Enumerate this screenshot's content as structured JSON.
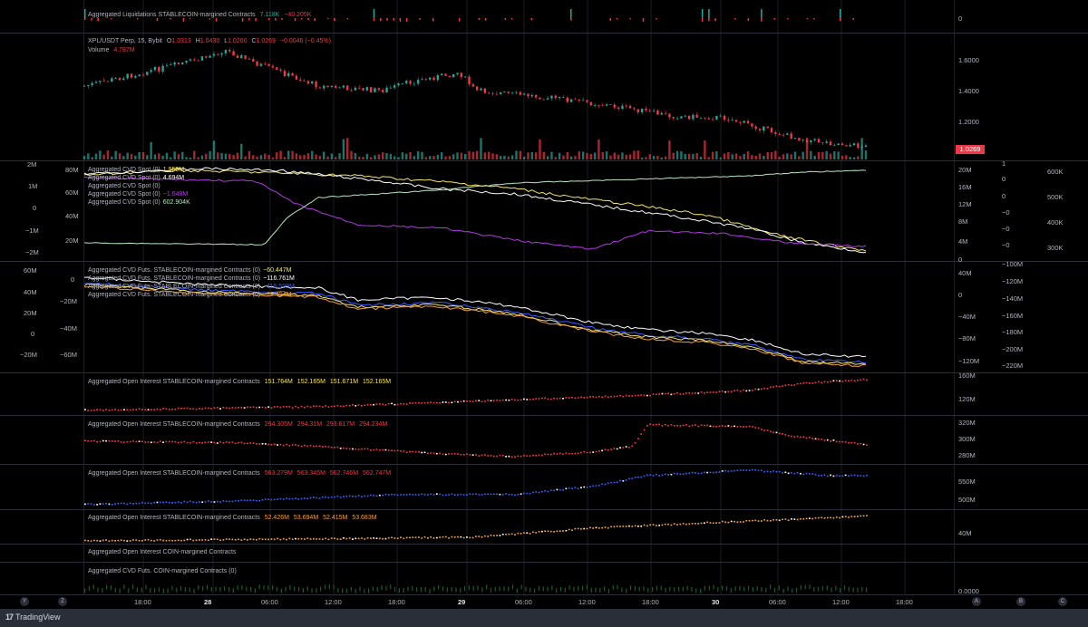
{
  "colors": {
    "up": "#26a69a",
    "down": "#f23645",
    "white": "#ffffff",
    "yellow": "#f5e663",
    "purple": "#b03adf",
    "mint": "#b8e6c0",
    "blue": "#3b5bff",
    "orange": "#f0a040",
    "grid": "#1a1d24",
    "text": "#b2b5be"
  },
  "liquidations": {
    "legend_title": "Aggregated Liquidations STABLECOIN-margined Contracts",
    "value_long": "7.118K",
    "value_short": "−40.205K",
    "right_scale": [
      "0"
    ]
  },
  "price": {
    "symbol_line": "XPL/USDT Perp, 15, Bybit",
    "o_label": "O",
    "o": "1.0313",
    "h_label": "H",
    "h": "1.0430",
    "l_label": "L",
    "l": "1.0260",
    "c_label": "C",
    "c": "1.0269",
    "change": "−0.0046 (−0.45%)",
    "volume_label": "Volume",
    "volume": "4.787M",
    "right_scale": [
      "1.6000",
      "1.4000",
      "1.2000"
    ],
    "last_price": "1.0269"
  },
  "cvd_spot": {
    "rows": [
      {
        "label": "Aggregated CVD Spot (0)",
        "value": "1.959M",
        "color": "#f5e663"
      },
      {
        "label": "Aggregated CVD Spot (0)",
        "value": "4.694M",
        "color": "#ffffff"
      },
      {
        "label": "Aggregated CVD Spot (0)",
        "value": "",
        "color": "#b8e6c0"
      },
      {
        "label": "Aggregated CVD Spot (0)",
        "value": "−1.648M",
        "color": "#b03adf"
      },
      {
        "label": "Aggregated CVD Spot (0)",
        "value": "602.904K",
        "color": "#b8e6c0"
      }
    ],
    "left_outer": [
      "2M",
      "1M",
      "0",
      "−1M",
      "−2M"
    ],
    "left_inner": [
      "80M",
      "60M",
      "40M",
      "20M"
    ],
    "right_a": [
      "20M",
      "16M",
      "12M",
      "8M",
      "4M",
      "0"
    ],
    "right_b": [
      "1",
      "0",
      "0",
      "−0",
      "−0",
      "−0"
    ],
    "right_c": [
      "600K",
      "500K",
      "400K",
      "300K"
    ]
  },
  "cvd_futs": {
    "rows": [
      {
        "label": "Aggregated CVD Futs. STABLECOIN-margined Contracts (0)",
        "value": "−60.447M",
        "color": "#f5e663"
      },
      {
        "label": "Aggregated CVD Futs. STABLECOIN-margined Contracts (0)",
        "value": "−116.761M",
        "color": "#ffffff"
      },
      {
        "label": "Aggregated CVD Futs. STABLECOIN-margined Contracts (0)",
        "value": "−116.509M",
        "color": "#3b5bff"
      },
      {
        "label": "Aggregated CVD Futs. STABLECOIN-margined Contracts (0)",
        "value": "−28.454M",
        "color": "#f0a040"
      }
    ],
    "left_outer": [
      "60M",
      "40M",
      "20M",
      "0",
      "−20M"
    ],
    "left_inner": [
      "0",
      "−20M",
      "−40M",
      "−60M"
    ],
    "right_a": [
      "40M",
      "0",
      "−40M",
      "−80M",
      "−120M"
    ],
    "right_b": [
      "−100M",
      "−120M",
      "−140M",
      "−160M",
      "−180M",
      "−200M",
      "−220M"
    ]
  },
  "oi_panes": [
    {
      "title": "Aggregated Open Interest STABLECOIN-margined Contracts",
      "values": [
        "151.764M",
        "152.165M",
        "151.671M",
        "152.165M"
      ],
      "color": "#f5e663",
      "right_scale": [
        "160M",
        "120M"
      ]
    },
    {
      "title": "Aggregated Open Interest STABLECOIN-margined Contracts",
      "values": [
        "294.305M",
        "294.31M",
        "293.617M",
        "294.234M"
      ],
      "color": "#f23645",
      "right_scale": [
        "320M",
        "300M",
        "280M"
      ]
    },
    {
      "title": "Aggregated Open Interest STABLECOIN-margined Contracts",
      "values": [
        "563.279M",
        "563.345M",
        "562.746M",
        "562.747M"
      ],
      "color": "#f23645",
      "right_scale": [
        "550M",
        "500M"
      ]
    },
    {
      "title": "Aggregated Open Interest STABLECOIN-margined Contracts",
      "values": [
        "52.426M",
        "53.694M",
        "52.415M",
        "53.683M"
      ],
      "color": "#f0a040",
      "right_scale": [
        "40M"
      ]
    }
  ],
  "oi_coin": {
    "title": "Aggregated Open Interest COIN-margined Contracts"
  },
  "cvd_coin": {
    "title": "Aggregated CVD Futs. COIN-margined Contracts (0)",
    "right_scale": [
      "0.0000"
    ]
  },
  "time_axis": {
    "labels": [
      "18:00",
      "28",
      "06:00",
      "12:00",
      "18:00",
      "29",
      "06:00",
      "12:00",
      "18:00",
      "30",
      "06:00",
      "12:00",
      "18:00"
    ],
    "day_flags": [
      false,
      true,
      false,
      false,
      false,
      true,
      false,
      false,
      false,
      true,
      false,
      false,
      false
    ]
  },
  "corner_buttons": [
    "Y",
    "Z",
    "A",
    "B",
    "C"
  ],
  "footer": {
    "brand": "TradingView",
    "logo_text": "17"
  }
}
